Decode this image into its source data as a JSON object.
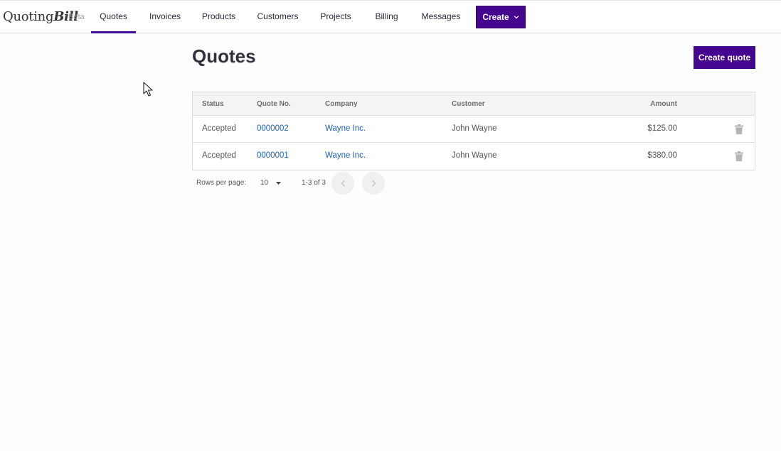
{
  "app": {
    "logo_regular": "Quoting",
    "logo_bold": "Bill",
    "beta": "Beta"
  },
  "nav": {
    "items": [
      {
        "label": "Quotes"
      },
      {
        "label": "Invoices"
      },
      {
        "label": "Products"
      },
      {
        "label": "Customers"
      },
      {
        "label": "Projects"
      },
      {
        "label": "Billing"
      },
      {
        "label": "Messages"
      }
    ],
    "active": "Quotes",
    "create_label": "Create"
  },
  "page": {
    "title": "Quotes",
    "create_button": "Create quote"
  },
  "table": {
    "headers": {
      "status": "Status",
      "quote_no": "Quote No.",
      "company": "Company",
      "customer": "Customer",
      "amount": "Amount"
    },
    "rows": [
      {
        "status": "Accepted",
        "quote_no": "0000002",
        "company": "Wayne Inc.",
        "customer": "John Wayne",
        "amount": "$125.00"
      },
      {
        "status": "Accepted",
        "quote_no": "0000001",
        "company": "Wayne Inc.",
        "customer": "John Wayne",
        "amount": "$380.00"
      }
    ]
  },
  "pagination": {
    "rows_per_page_label": "Rows per page:",
    "rows_per_page": "10",
    "range": "1-3 of 3"
  },
  "colors": {
    "accent": "#45068f",
    "link": "#1f5fb5"
  }
}
